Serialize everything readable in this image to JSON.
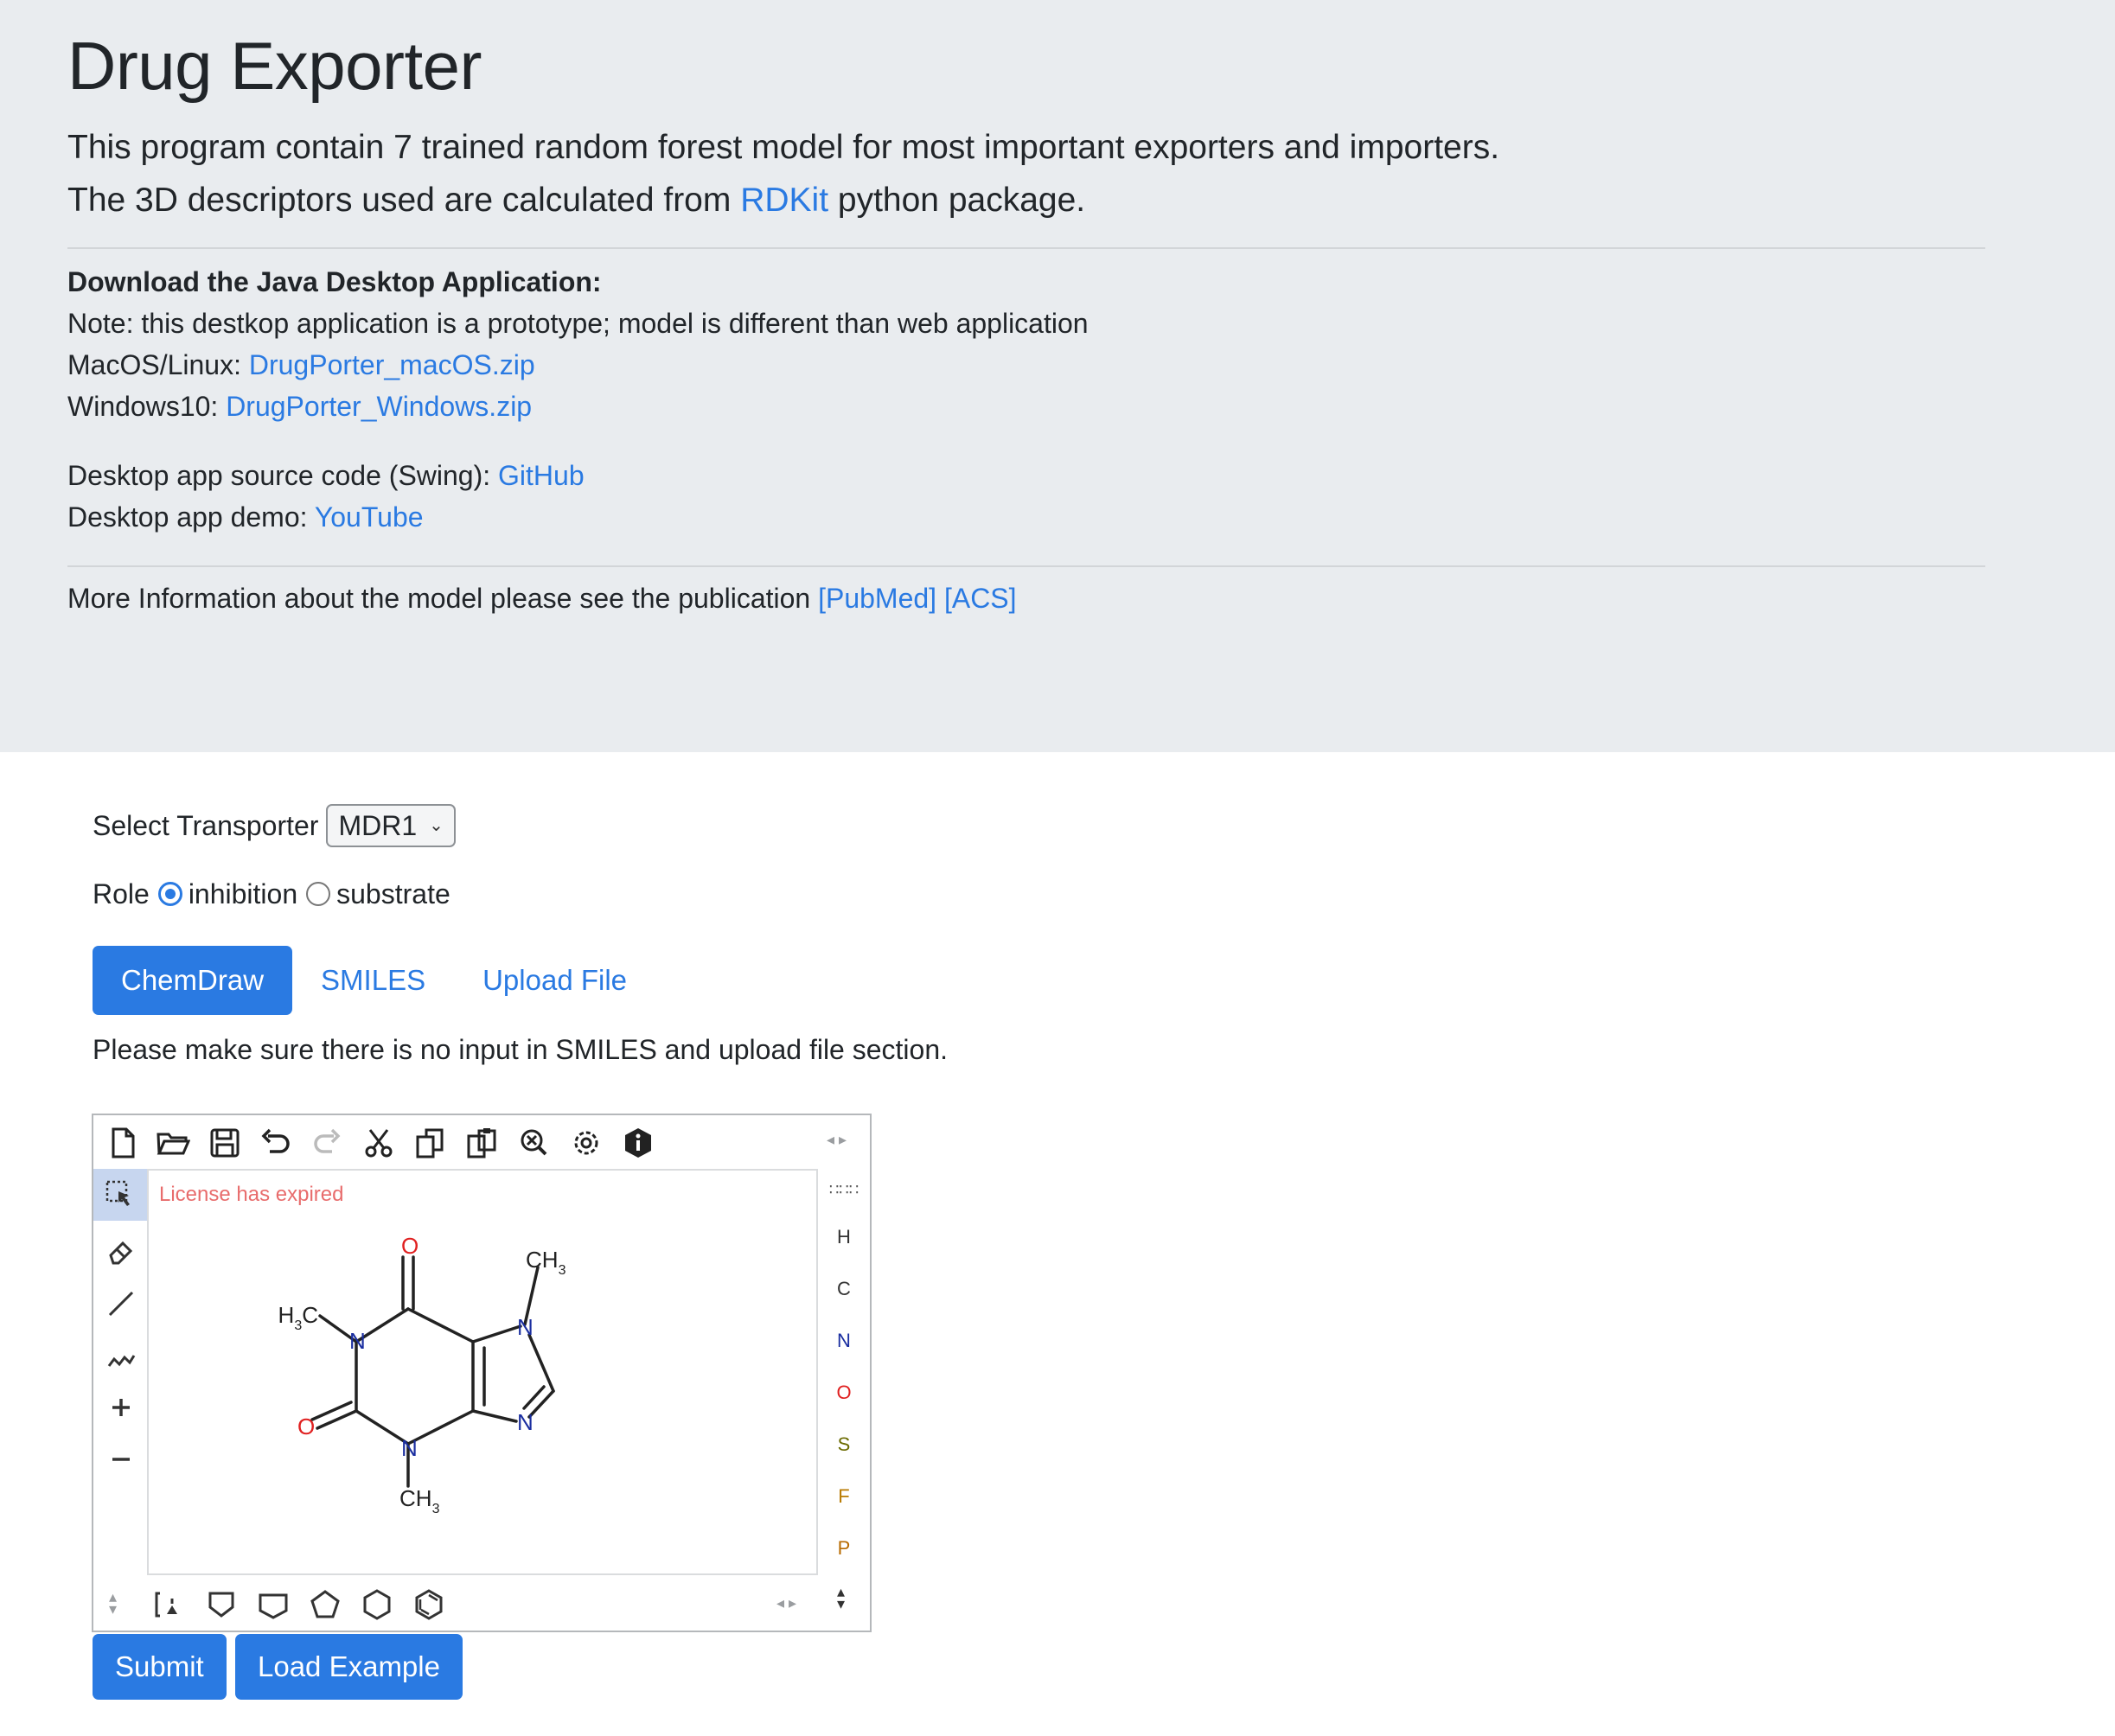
{
  "header": {
    "title": "Drug Exporter",
    "lead_line1": "This program contain 7 trained random forest model for most important exporters and importers.",
    "lead_line2_prefix": "The 3D descriptors used are calculated from ",
    "lead_line2_link": "RDKit",
    "lead_line2_suffix": " python package."
  },
  "download": {
    "heading": "Download the Java Desktop Application:",
    "note": "Note: this destkop application is a prototype; model is different than web application",
    "mac_label": "MacOS/Linux: ",
    "mac_link": "DrugPorter_macOS.zip",
    "win_label": "Windows10: ",
    "win_link": "DrugPorter_Windows.zip",
    "source_label": "Desktop app source code (Swing): ",
    "source_link": "GitHub",
    "demo_label": "Desktop app demo: ",
    "demo_link": "YouTube"
  },
  "more_info": {
    "text": "More Information about the model please see the publication ",
    "pubmed_link": "[PubMed]",
    "acs_link": "[ACS]"
  },
  "form": {
    "transporter_label": "Select Transporter",
    "transporter_value": "MDR1",
    "role_label": "Role",
    "role_options": [
      "inhibition",
      "substrate"
    ],
    "role_selected": "inhibition",
    "tabs": [
      "ChemDraw",
      "SMILES",
      "Upload File"
    ],
    "active_tab": "ChemDraw",
    "note": "Please make sure there is no input in SMILES and upload file section."
  },
  "editor": {
    "license_text": "License has expired",
    "atoms": [
      {
        "symbol": "H",
        "color": "#333333"
      },
      {
        "symbol": "C",
        "color": "#333333"
      },
      {
        "symbol": "N",
        "color": "#1a2ea0"
      },
      {
        "symbol": "O",
        "color": "#e02020"
      },
      {
        "symbol": "S",
        "color": "#6b6b00"
      },
      {
        "symbol": "F",
        "color": "#b87a00"
      },
      {
        "symbol": "P",
        "color": "#b86a00"
      }
    ],
    "molecule_labels": {
      "o_top": "O",
      "o_left": "O",
      "ch3_top": "CH",
      "ch3_bottom": "CH",
      "h3c": "H",
      "c_after_h3": "C",
      "sub_3": "3",
      "n1": "N",
      "n3": "N",
      "n7": "N",
      "n9": "N"
    },
    "toolbar_icons": [
      "new-icon",
      "open-icon",
      "save-icon",
      "undo-icon",
      "redo-icon",
      "cut-icon",
      "copy-icon",
      "paste-icon",
      "zoom-clear-icon",
      "settings-icon",
      "info-icon"
    ]
  },
  "buttons": {
    "submit": "Submit",
    "load_example": "Load Example"
  }
}
